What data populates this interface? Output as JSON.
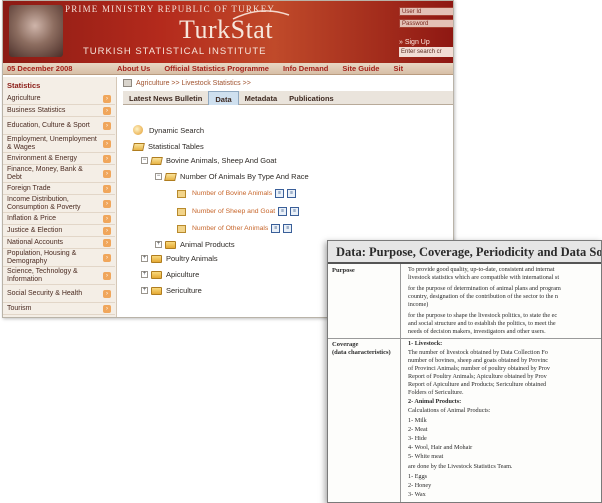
{
  "site": {
    "pm_line": "Prime Ministry Republic of Turkey",
    "logo": "TurkStat",
    "institute": "TURKISH STATISTICAL INSTITUTE",
    "login": {
      "user_label": "User Id",
      "password_label": "Password",
      "signup": "» Sign Up",
      "search_hint": "Enter search cr"
    },
    "date": "05 December 2008",
    "nav": [
      "About Us",
      "Official Statistics Programme",
      "Info Demand",
      "Site Guide",
      "Sit"
    ],
    "sidebar": {
      "title": "Statistics",
      "items": [
        "Agriculture",
        "Business Statistics",
        "Education, Culture & Sport",
        "Employment, Unemployment & Wages",
        "Environment & Energy",
        "Finance, Money, Bank & Debt",
        "Foreign Trade",
        "Income Distribution, Consumption & Poverty",
        "Inflation & Price",
        "Justice & Election",
        "National Accounts",
        "Population, Housing & Demography",
        "Science, Technology & Information",
        "Social Security & Health",
        "Tourism"
      ]
    },
    "breadcrumb": "Agriculture >> Livestock Statistics >>",
    "tabs": [
      "Latest News Bulletin",
      "Data",
      "Metadata",
      "Publications"
    ],
    "active_tab": "Data",
    "tree": {
      "dynamic_search": "Dynamic Search",
      "statistical_tables": "Statistical Tables",
      "bovine": "Bovine Animals, Sheep And Goat",
      "by_type": "Number Of Animals By Type And Race",
      "leaf1": "Number of Bovine Animals",
      "leaf2": "Number of Sheep and Goat",
      "leaf3": "Number of Other Animals",
      "animal_products": "Animal Products",
      "poultry": "Poultry Animals",
      "apiculture": "Apiculture",
      "sericulture": "Sericulture"
    }
  },
  "doc": {
    "title": "Data: Purpose, Coverage, Periodicity and Data Source",
    "purpose_label": "Purpose",
    "coverage_label": "Coverage",
    "coverage_sub": "(data characteristics)",
    "purpose_lines": [
      "To provide good quality, up-to-date, consistent and internat",
      "livestock statistics which are compatible with international st",
      "for the purpose of determination of animal plans and program",
      "country, designation of the contribution of the sector to the n",
      "income)",
      "for the purpose to shape the livestock politics, to state the ec",
      "and social structure and to establish the politics, to meet the",
      "needs of decision makers, investigators and other users."
    ],
    "coverage_lines": [
      "1-  Livestock:",
      "The number of livestock obtained by Data Collection Fo",
      "number of bovines, sheep and goats obtained by Provinc",
      "of Provinci Animals; number of poultry obtained by Prov",
      "Report of Poultry Animals; Apiculture obtained by Prov",
      "Report of Apiculture and Products; Sericulture obtained",
      "Folders of Sericulture.",
      "2-  Animal Products:",
      "Calculations of Animal Products:",
      "1- Milk",
      "2- Meat",
      "3- Hide",
      "4- Wool, Hair and Mohair",
      "5- White meat",
      "are done by the Livestock Statistics Team.",
      "1- Eggs",
      "2- Honey",
      "3- Wax"
    ]
  }
}
